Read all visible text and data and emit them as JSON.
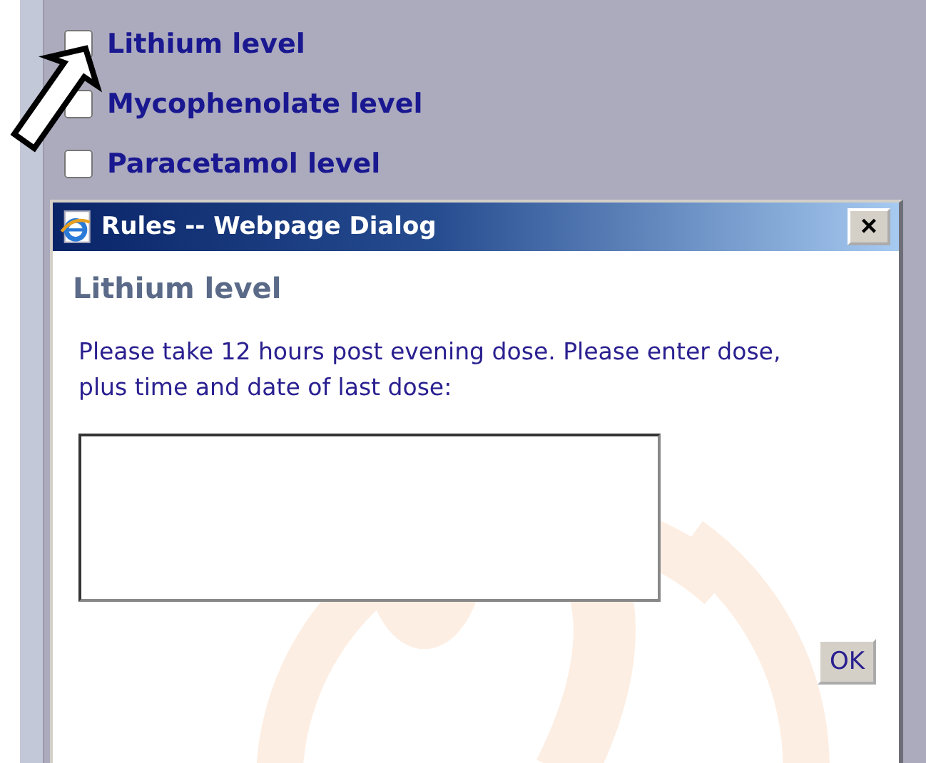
{
  "options": [
    {
      "label": "Lithium level",
      "checked": false
    },
    {
      "label": "Mycophenolate level",
      "checked": false
    },
    {
      "label": "Paracetamol level",
      "checked": false
    }
  ],
  "dialog": {
    "title": "Rules -- Webpage Dialog",
    "close": "×",
    "heading": "Lithium level",
    "message": "Please take 12 hours post evening dose. Please enter dose, plus time and date of last dose:",
    "button": "OK"
  }
}
